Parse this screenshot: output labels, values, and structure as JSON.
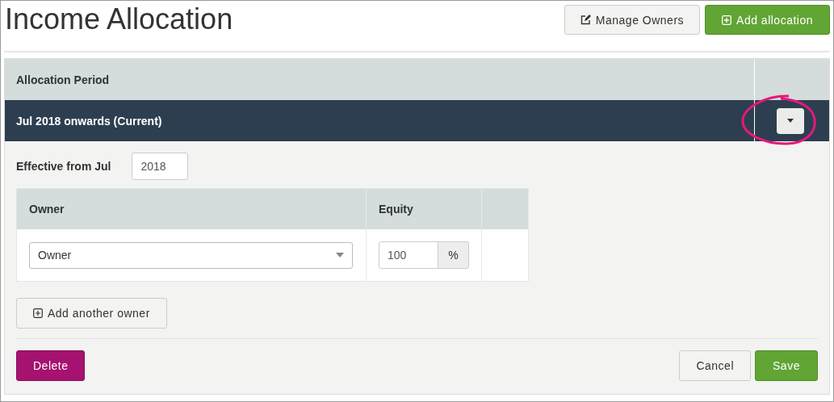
{
  "title": "Income Allocation",
  "header_buttons": [
    {
      "label": "Manage Owners",
      "kind": "edit"
    },
    {
      "label": "Add allocation",
      "kind": "add"
    }
  ],
  "periods_table": {
    "columns": [
      "Allocation Period"
    ],
    "rows": [
      {
        "label": "Jul 2018 onwards (Current)",
        "expanded": true
      }
    ]
  },
  "effective": {
    "label": "Effective from Jul",
    "value": "2018"
  },
  "owners_table": {
    "columns": [
      "Owner",
      "Equity"
    ],
    "rows": [
      {
        "owner": "Owner",
        "equity": "100",
        "unit": "%"
      }
    ]
  },
  "add_owner_button": "Add another owner",
  "footer": {
    "delete": "Delete",
    "cancel": "Cancel",
    "save": "Save"
  }
}
